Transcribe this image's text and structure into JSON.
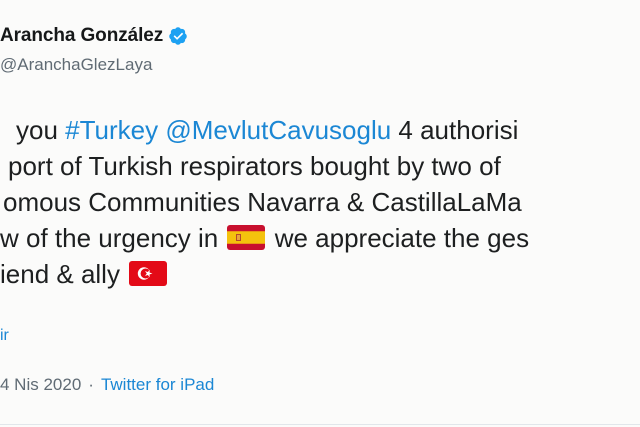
{
  "author": {
    "name": "Arancha González",
    "handle": "@AranchaGlezLaya",
    "verified": true
  },
  "tweet": {
    "line1": {
      "pre": "you ",
      "hashtag": "#Turkey",
      "space": " ",
      "mention": "@MevlutCavusoglu",
      "post": " 4 authorisi"
    },
    "line2": "port of Turkish respirators bought by two of",
    "line3": "omous Communities Navarra & CastillaLaMa",
    "line4": {
      "pre": "w of the urgency in ",
      "post": " we appreciate the ges"
    },
    "line5": {
      "pre": "iend & ally "
    },
    "translate": "ir"
  },
  "meta": {
    "date": "4 Nis 2020",
    "separator": "·",
    "source": "Twitter for iPad"
  },
  "colors": {
    "link": "#1b87d4",
    "verified": "#1da1f2",
    "text": "#1d1f20",
    "muted": "#606b74"
  },
  "icons": {
    "verified": "verified-badge-icon",
    "spain_flag": "spain-flag-icon",
    "turkey_flag": "turkey-flag-icon"
  }
}
